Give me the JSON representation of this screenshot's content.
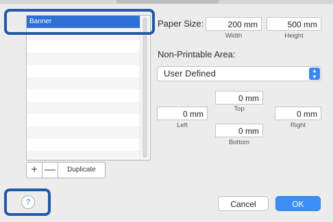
{
  "list": {
    "items": [
      "Banner",
      "",
      "",
      "",
      "",
      "",
      "",
      "",
      "",
      "",
      "",
      ""
    ],
    "selected_index": 0
  },
  "buttons": {
    "add": "+",
    "remove": "—",
    "duplicate": "Duplicate",
    "help": "?",
    "cancel": "Cancel",
    "ok": "OK"
  },
  "paper_size": {
    "label": "Paper Size:",
    "width": "200 mm",
    "width_label": "Width",
    "height": "500 mm",
    "height_label": "Height"
  },
  "non_printable": {
    "label": "Non-Printable Area:",
    "selected": "User Defined",
    "top": "0 mm",
    "top_label": "Top",
    "left": "0 mm",
    "left_label": "Left",
    "right": "0 mm",
    "right_label": "Right",
    "bottom": "0 mm",
    "bottom_label": "Bottom"
  },
  "colors": {
    "selection": "#2d6fd3",
    "accent_button": "#3a8ef5",
    "callout": "#2357a8"
  }
}
